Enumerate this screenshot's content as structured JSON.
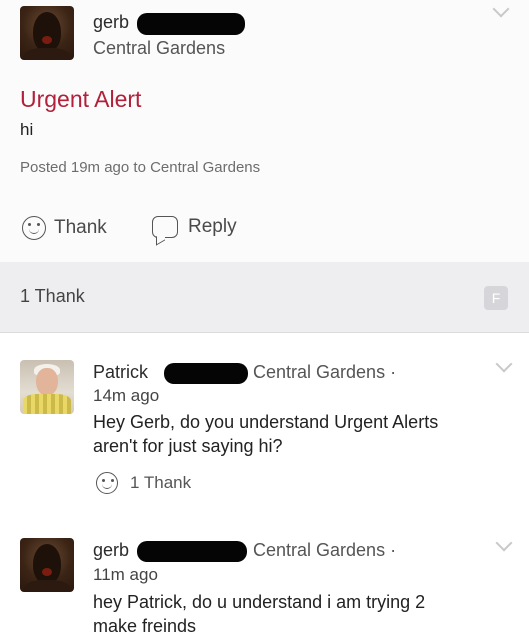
{
  "post": {
    "author": "gerb",
    "neighborhood": "Central Gardens",
    "title": "Urgent Alert",
    "body": "hi",
    "meta": "Posted 19m ago to Central Gardens",
    "actions": {
      "thank": "Thank",
      "reply": "Reply"
    }
  },
  "thanks": {
    "count_label": "1 Thank",
    "badge": "F"
  },
  "replies": [
    {
      "author": "Patrick",
      "neighborhood": "Central Gardens ·",
      "time": "14m ago",
      "text": "Hey Gerb, do you understand Urgent Alerts aren't for just saying hi?",
      "thank_label": "1 Thank"
    },
    {
      "author": "gerb",
      "neighborhood": "Central Gardens ·",
      "time": "11m ago",
      "text": "hey Patrick, do u understand i am trying 2 make freinds"
    }
  ],
  "colors": {
    "alert_title": "#b2203a",
    "thanks_bar": "#eeeef0"
  }
}
